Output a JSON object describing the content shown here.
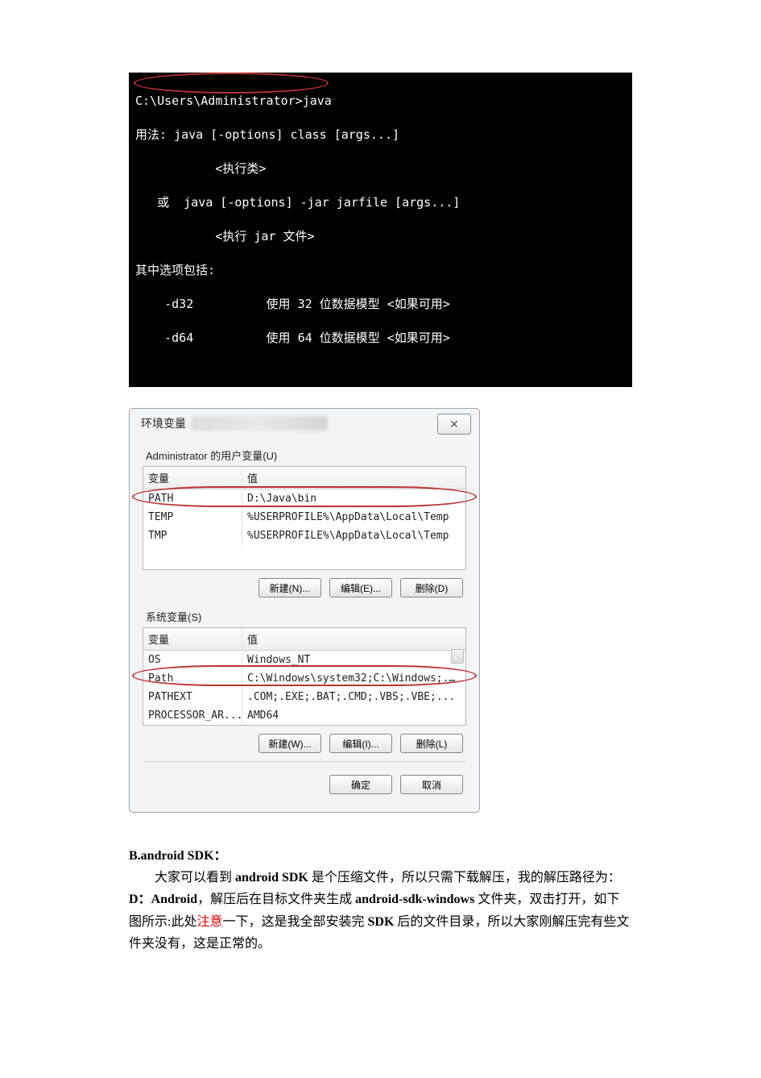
{
  "console": {
    "lines": [
      "C:\\Users\\Administrator>java",
      "用法: java [-options] class [args...]",
      "           <执行类>",
      "   或  java [-options] -jar jarfile [args...]",
      "           <执行 jar 文件>",
      "其中选项包括:",
      "    -d32          使用 32 位数据模型 <如果可用>",
      "    -d64          使用 64 位数据模型 <如果可用>"
    ]
  },
  "dialog": {
    "title": "环境变量",
    "close_glyph": "✕",
    "user_section_label": "Administrator 的用户变量(U)",
    "col_name": "变量",
    "col_value": "值",
    "user_vars": [
      {
        "name": "PATH",
        "value": "D:\\Java\\bin"
      },
      {
        "name": "TEMP",
        "value": "%USERPROFILE%\\AppData\\Local\\Temp"
      },
      {
        "name": "TMP",
        "value": "%USERPROFILE%\\AppData\\Local\\Temp"
      }
    ],
    "user_buttons": {
      "new": "新建(N)...",
      "edit": "编辑(E)...",
      "delete": "删除(D)"
    },
    "sys_section_label": "系统变量(S)",
    "sys_vars": [
      {
        "name": "OS",
        "value": "Windows_NT"
      },
      {
        "name": "Path",
        "value": "C:\\Windows\\system32;C:\\Windows;..."
      },
      {
        "name": "PATHEXT",
        "value": ".COM;.EXE;.BAT;.CMD;.VBS;.VBE;..."
      },
      {
        "name": "PROCESSOR_AR...",
        "value": "AMD64"
      }
    ],
    "sys_buttons": {
      "new": "新建(W)...",
      "edit": "编辑(I)...",
      "delete": "删除(L)"
    },
    "footer_buttons": {
      "ok": "确定",
      "cancel": "取消"
    }
  },
  "body": {
    "heading": "B.android SDK：",
    "p1_seg1": "大家可以看到 ",
    "p1_bold1": "android  SDK",
    "p1_seg2": " 是个压缩文件，所以只需下载解压，我的解压路径为：",
    "p1_bold2": "D：Android",
    "p1_seg3": "，解压后在目标文件夹生成 ",
    "p1_bold3": "android-sdk-windows",
    "p1_seg4": " 文件夹，双击打开，如下图所示:此处",
    "p1_red": "注意",
    "p1_seg5": "一下，这是我全部安装完 ",
    "p1_bold4": "SDK",
    "p1_seg6": " 后的文件目录，所以大家刚解压完有些文件夹没有，这是正常的。"
  }
}
